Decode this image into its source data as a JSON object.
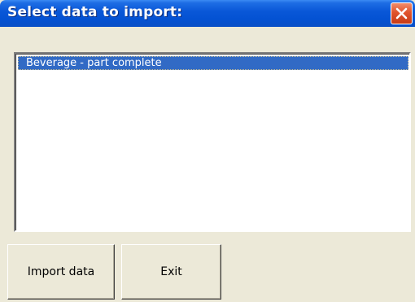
{
  "window": {
    "title": "Select data to import:"
  },
  "list": {
    "items": [
      {
        "label": "Beverage - part complete",
        "selected": true
      }
    ]
  },
  "buttons": {
    "import_label": "Import data",
    "exit_label": "Exit"
  },
  "icons": {
    "close": "close-icon"
  },
  "colors": {
    "titlebar": "#0a58d8",
    "selection": "#316ac5",
    "close_button": "#e0532c",
    "dialog_background": "#ece9d8"
  }
}
